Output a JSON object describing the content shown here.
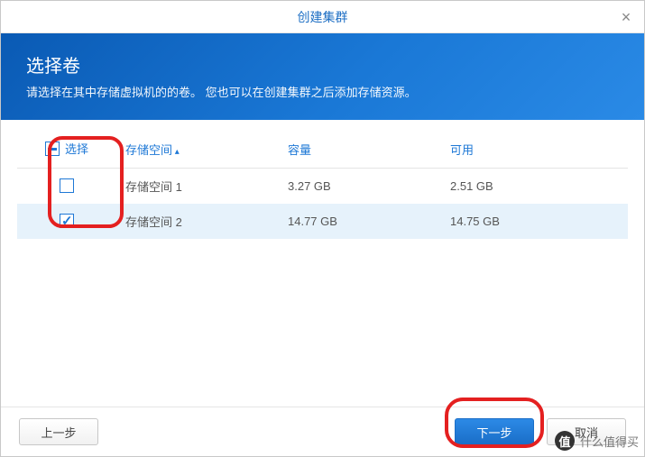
{
  "dialog": {
    "title": "创建集群",
    "close_label": "×"
  },
  "banner": {
    "heading": "选择卷",
    "subtext": "请选择在其中存储虚拟机的的卷。 您也可以在创建集群之后添加存储资源。"
  },
  "table": {
    "headers": {
      "select": "选择",
      "storage": "存储空间",
      "capacity": "容量",
      "available": "可用"
    },
    "rows": [
      {
        "checked": false,
        "storage": "存储空间 1",
        "capacity": "3.27 GB",
        "available": "2.51 GB"
      },
      {
        "checked": true,
        "storage": "存储空间 2",
        "capacity": "14.77 GB",
        "available": "14.75 GB"
      }
    ]
  },
  "footer": {
    "back": "上一步",
    "next": "下一步",
    "cancel": "取消"
  },
  "watermark": {
    "logo": "值",
    "text": "什么值得买"
  }
}
